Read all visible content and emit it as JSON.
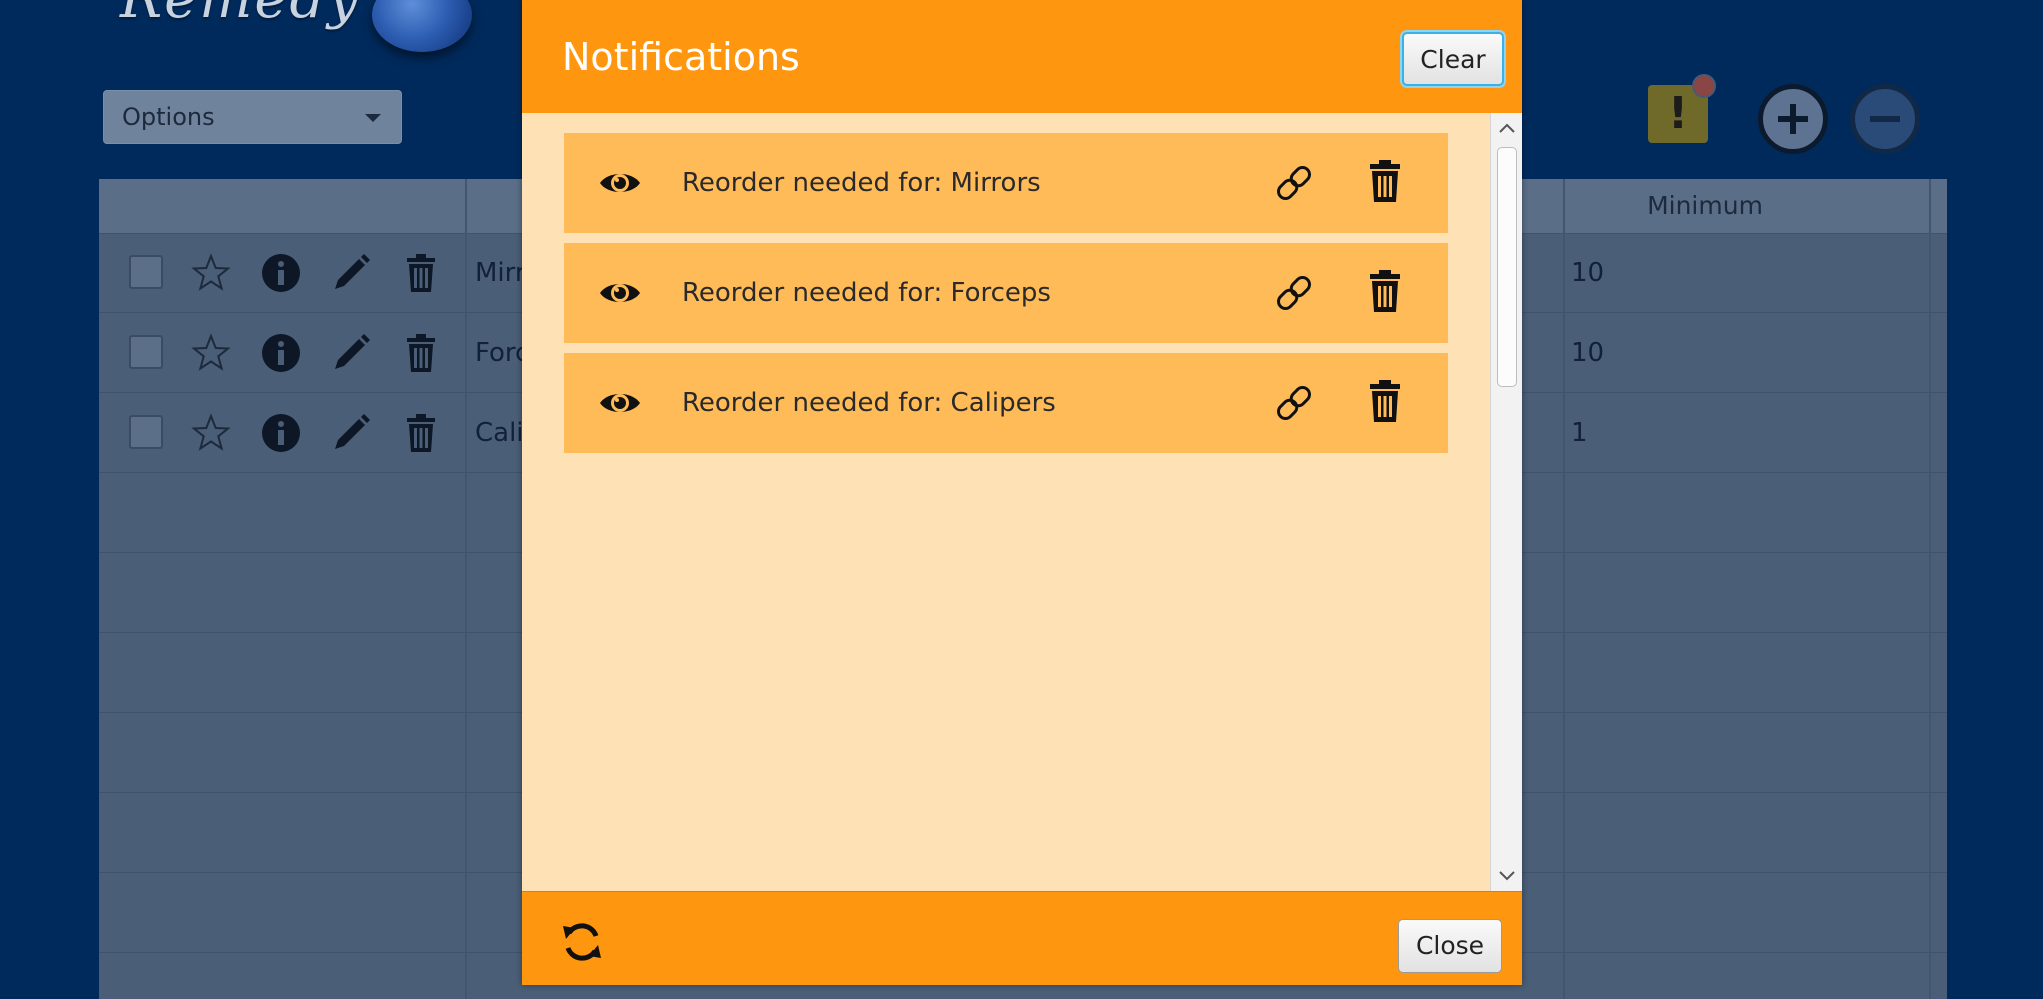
{
  "app": {
    "logo_text": "Remedy",
    "options_select": {
      "value": "Options"
    },
    "notification_count_badge": "",
    "table": {
      "columns": {
        "minimum": "Minimum"
      },
      "rows": [
        {
          "name": "Mirrors",
          "minimum": "10"
        },
        {
          "name": "Forceps",
          "minimum": "10"
        },
        {
          "name": "Calipers",
          "minimum": "1"
        }
      ]
    }
  },
  "modal": {
    "title": "Notifications",
    "clear_label": "Clear",
    "close_label": "Close",
    "notifications": [
      {
        "text": "Reorder needed for: Mirrors"
      },
      {
        "text": "Reorder needed for: Forceps"
      },
      {
        "text": "Reorder needed for: Calipers"
      }
    ]
  },
  "colors": {
    "background": "#002a5c",
    "modal_accent": "#ff9610",
    "modal_body": "#ffe1b6",
    "notification_item": "#ffbb57",
    "focus_ring": "#3bb1e6"
  },
  "icons": [
    "eye-icon",
    "link-icon",
    "trash-icon",
    "refresh-icon",
    "star-icon",
    "info-icon",
    "pencil-icon",
    "plus-icon",
    "minus-icon",
    "exclamation-icon"
  ]
}
